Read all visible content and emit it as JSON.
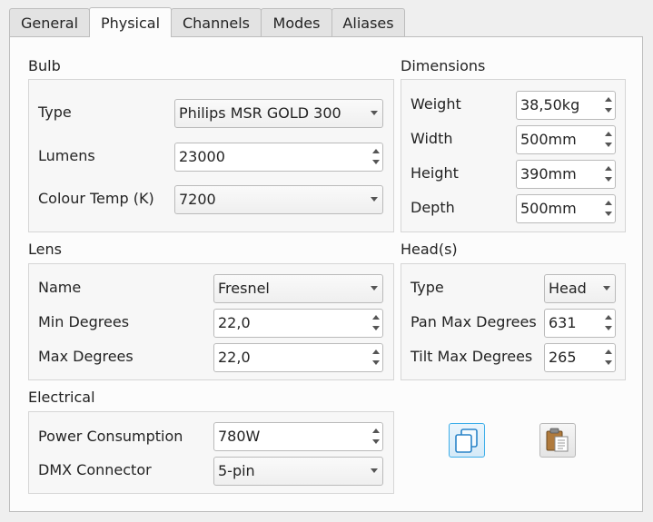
{
  "tabs": [
    {
      "label": "General"
    },
    {
      "label": "Physical"
    },
    {
      "label": "Channels"
    },
    {
      "label": "Modes"
    },
    {
      "label": "Aliases"
    }
  ],
  "active_tab": "Physical",
  "bulb": {
    "title": "Bulb",
    "type_label": "Type",
    "type_value": "Philips MSR GOLD 300",
    "lumens_label": "Lumens",
    "lumens_value": "23000",
    "temp_label": "Colour Temp (K)",
    "temp_value": "7200"
  },
  "dimensions": {
    "title": "Dimensions",
    "weight_label": "Weight",
    "weight_value": "38,50kg",
    "width_label": "Width",
    "width_value": "500mm",
    "height_label": "Height",
    "height_value": "390mm",
    "depth_label": "Depth",
    "depth_value": "500mm"
  },
  "lens": {
    "title": "Lens",
    "name_label": "Name",
    "name_value": "Fresnel",
    "min_label": "Min Degrees",
    "min_value": "22,0",
    "max_label": "Max Degrees",
    "max_value": "22,0"
  },
  "head": {
    "title": "Head(s)",
    "type_label": "Type",
    "type_value": "Head",
    "pan_label": "Pan Max Degrees",
    "pan_value": "631",
    "tilt_label": "Tilt Max Degrees",
    "tilt_value": "265"
  },
  "electrical": {
    "title": "Electrical",
    "power_label": "Power Consumption",
    "power_value": "780W",
    "dmx_label": "DMX Connector",
    "dmx_value": "5-pin"
  },
  "icons": {
    "copy": "copy-icon",
    "paste": "paste-icon"
  },
  "colors": {
    "accent": "#3daee9"
  }
}
